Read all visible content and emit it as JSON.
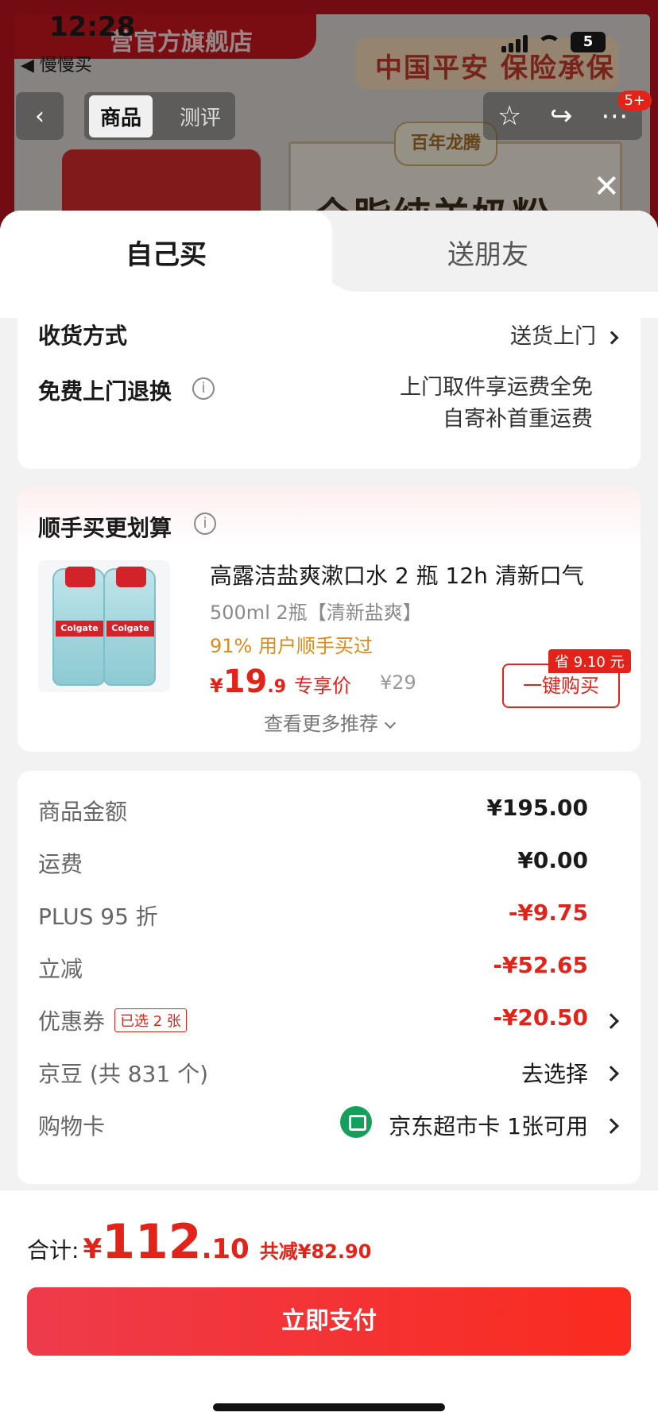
{
  "status_bar": {
    "time": "12:28",
    "back_app": "◀ 慢慢买",
    "battery": "5"
  },
  "background_page": {
    "store_name": "营官方旗舰店",
    "insurance_banner": "中国平安 保险承保",
    "product_brand": "百年龙腾",
    "product_title": "全脂纯羊奶粉",
    "nav_tabs": [
      "商品",
      "测评"
    ],
    "nav_badge": "5+"
  },
  "sheet": {
    "tabs": {
      "self": "自己买",
      "gift": "送朋友"
    },
    "shipping": {
      "method_label": "收货方式",
      "method_value": "送货上门",
      "return_label": "免费上门退换",
      "return_line1": "上门取件享运费全免",
      "return_line2": "自寄补首重运费"
    },
    "recommend": {
      "title": "顺手买更划算",
      "product_name": "高露洁盐爽漱口水 2 瓶 12h 清新口气",
      "spec": "500ml 2瓶【清新盐爽】",
      "bought_rate": "91% 用户顺手买过",
      "price_currency": "¥",
      "price_int": "19",
      "price_dec": ".9",
      "price_tag": "专享价",
      "orig_price": "¥29",
      "save_badge": "省 9.10 元",
      "buy_button": "一键购买",
      "more": "查看更多推荐",
      "bottle_brand": "Colgate"
    },
    "summary": {
      "rows": [
        {
          "label": "商品金额",
          "value": "¥195.00"
        },
        {
          "label": "运费",
          "value": "¥0.00"
        },
        {
          "label": "PLUS 95 折",
          "value": "-¥9.75"
        },
        {
          "label": "立减",
          "value": "-¥52.65"
        },
        {
          "label": "优惠券",
          "chip": "已选 2 张",
          "value": "-¥20.50"
        },
        {
          "label": "京豆 (共 831 个)",
          "value": "去选择"
        },
        {
          "label": "购物卡",
          "value": "京东超市卡  1张可用"
        }
      ]
    }
  },
  "footer": {
    "total_label": "合计:",
    "currency": "¥",
    "total_int": "112",
    "total_dec": ".10",
    "total_save": "共减¥82.90",
    "pay_button": "立即支付"
  },
  "colors": {
    "accent_red": "#e2231a",
    "pay_gradient_start": "#ee3b4b",
    "pay_gradient_end": "#fa2b1f",
    "bought_orange": "#d98c1b"
  }
}
